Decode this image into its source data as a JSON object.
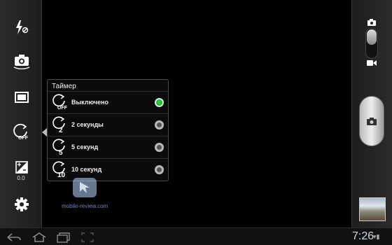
{
  "left_toolbar": {
    "items": [
      {
        "name": "flash-off"
      },
      {
        "name": "self-portrait"
      },
      {
        "name": "aspect"
      },
      {
        "name": "timer-off"
      },
      {
        "name": "exposure"
      },
      {
        "name": "settings"
      }
    ],
    "exposure_value": "0.0",
    "timer_off_label": "OFF"
  },
  "timer_popup": {
    "title": "Таймер",
    "options": [
      {
        "label": "Выключено",
        "icon_text": "OFF",
        "selected": true
      },
      {
        "label": "2 секунды",
        "icon_text": "2",
        "selected": false
      },
      {
        "label": "5 секунд",
        "icon_text": "5",
        "selected": false
      },
      {
        "label": "10 секунд",
        "icon_text": "10",
        "selected": false
      }
    ]
  },
  "watermark": {
    "text": "mobile-review.com"
  },
  "right_bar": {
    "mode": "photo",
    "accent": "#2bd12b"
  },
  "status": {
    "time": "7:26",
    "icons": "▾▮"
  },
  "nav": {
    "buttons": [
      "back",
      "home",
      "recent-apps",
      "screenshot"
    ]
  }
}
